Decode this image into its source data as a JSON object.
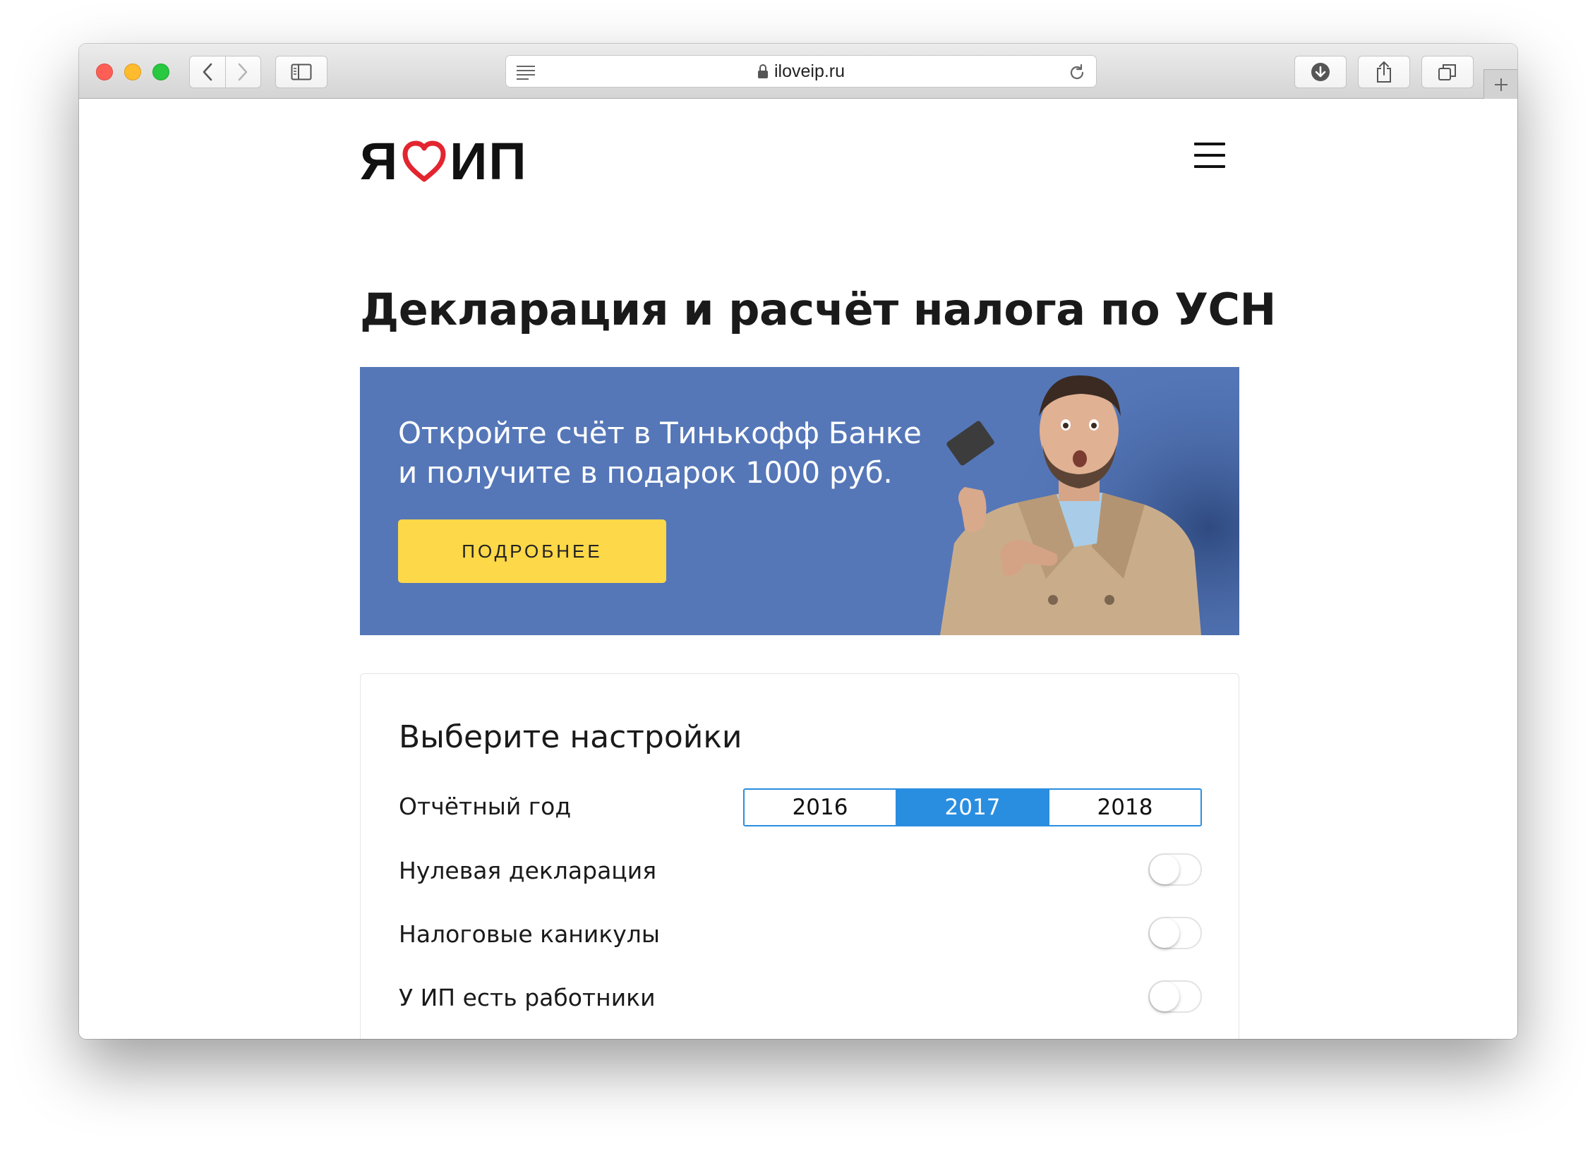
{
  "browser": {
    "url": "iloveip.ru",
    "colors": {
      "close": "#fd5f57",
      "minimize": "#febb2e",
      "zoom": "#28c840"
    },
    "icons": [
      "back-icon",
      "forward-icon",
      "sidebar-icon",
      "reader-icon",
      "lock-icon",
      "reload-icon",
      "download-icon",
      "share-icon",
      "tabs-icon",
      "plus-icon"
    ]
  },
  "header": {
    "logo_left": "Я",
    "logo_right": "ИП",
    "logo_heart_color": "#e32530"
  },
  "page_title": "Декларация и расчёт налога по УСН",
  "promo": {
    "line1": "Откройте счёт в Тинькофф Банке",
    "line2": "и получите в подарок 1000 руб.",
    "button_label": "ПОДРОБНЕЕ",
    "background_color": "#5577b8",
    "button_color": "#fdd848"
  },
  "settings": {
    "title": "Выберите настройки",
    "year_label": "Отчётный год",
    "years": [
      "2016",
      "2017",
      "2018"
    ],
    "selected_year": "2017",
    "accent_color": "#2a8ee0",
    "toggles": [
      {
        "label": "Нулевая декларация",
        "on": false
      },
      {
        "label": "Налоговые каникулы",
        "on": false
      },
      {
        "label": "У ИП есть работники",
        "on": false
      }
    ]
  }
}
